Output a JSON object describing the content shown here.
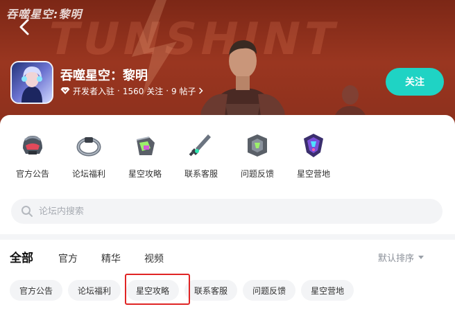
{
  "watermark": "吞噬星空:黎明",
  "banner": {
    "background_word": "TUNSHINT"
  },
  "header": {
    "game_title": "吞噬星空：黎明",
    "developer_label": "开发者入驻",
    "followers": "1560 关注",
    "posts": "9 帖子",
    "separator": "·",
    "follow_label": "关注"
  },
  "quick_nav": [
    {
      "label": "官方公告",
      "icon": "helmet-icon"
    },
    {
      "label": "论坛福利",
      "icon": "ring-icon"
    },
    {
      "label": "星空攻略",
      "icon": "gauntlet-icon"
    },
    {
      "label": "联系客服",
      "icon": "dagger-icon"
    },
    {
      "label": "问题反馈",
      "icon": "armor-icon"
    },
    {
      "label": "星空营地",
      "icon": "shield-icon"
    }
  ],
  "search": {
    "placeholder": "论坛内搜索"
  },
  "tabs": [
    {
      "label": "全部",
      "active": true
    },
    {
      "label": "官方",
      "active": false
    },
    {
      "label": "精华",
      "active": false
    },
    {
      "label": "视频",
      "active": false
    }
  ],
  "sort": {
    "label": "默认排序"
  },
  "chips": [
    {
      "label": "官方公告"
    },
    {
      "label": "论坛福利"
    },
    {
      "label": "星空攻略",
      "highlighted": true
    },
    {
      "label": "联系客服"
    },
    {
      "label": "问题反馈"
    },
    {
      "label": "星空营地"
    }
  ],
  "colors": {
    "accent": "#1fd3c4",
    "banner": "#8a2f1c",
    "highlight": "#e02424"
  }
}
